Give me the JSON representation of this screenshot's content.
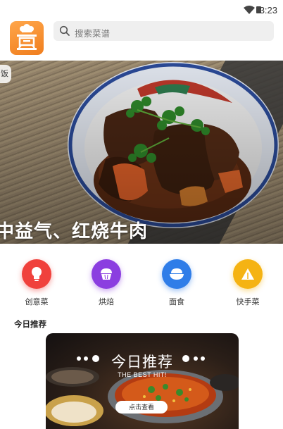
{
  "status_bar": {
    "time": "3:23"
  },
  "header": {
    "search_placeholder": "搜索菜谱"
  },
  "banner": {
    "prev_tag": "饭",
    "caption": "中益气、红烧牛肉"
  },
  "categories": [
    {
      "label": "创意菜",
      "icon": "lightbulb-icon",
      "color": "#f0413c"
    },
    {
      "label": "烘焙",
      "icon": "cupcake-icon",
      "color": "#8b3ee0"
    },
    {
      "label": "面食",
      "icon": "rice-bowl-icon",
      "color": "#2f7de8"
    },
    {
      "label": "快手菜",
      "icon": "triangle-sandwich-icon",
      "color": "#f5b313"
    }
  ],
  "today": {
    "section_title": "今日推荐",
    "card_title": "今日推荐",
    "card_subtitle": "THE BEST HIT!",
    "button_label": "点击查看"
  }
}
